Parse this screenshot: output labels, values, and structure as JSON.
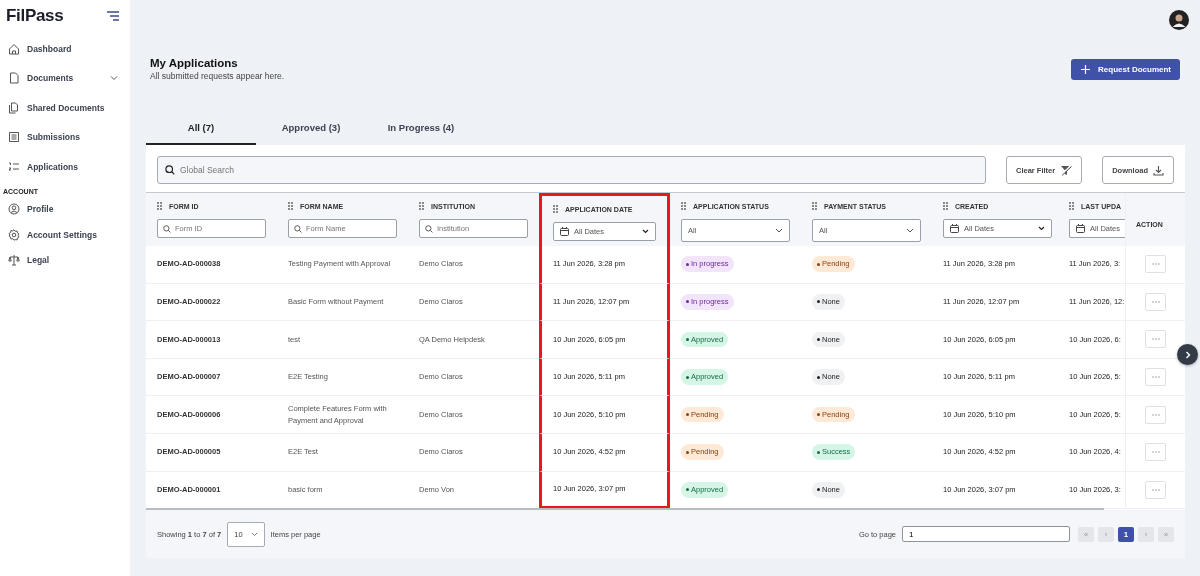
{
  "brand": {
    "logo": "FilPass"
  },
  "sidebar": {
    "items": [
      {
        "label": "Dashboard",
        "selected": false
      },
      {
        "label": "Documents",
        "selected": false,
        "expanded": false
      },
      {
        "label": "Shared Documents",
        "selected": false
      },
      {
        "label": "Submissions",
        "selected": false
      },
      {
        "label": "Applications",
        "selected": false
      }
    ],
    "section": "ACCOUNT",
    "account_items": [
      {
        "label": "Profile",
        "selected": false
      },
      {
        "label": "Account Settings",
        "selected": false
      },
      {
        "label": "Legal",
        "selected": false
      }
    ]
  },
  "header": {
    "title": "My Applications",
    "subtitle": "All submitted requests appear here.",
    "button": "Request Document"
  },
  "tabs": [
    {
      "label": "All (7)",
      "selected": true
    },
    {
      "label": "Approved (3)",
      "selected": false
    },
    {
      "label": "In Progress (4)",
      "selected": false
    }
  ],
  "search": {
    "placeholder": "Global Search"
  },
  "toolbar": {
    "clear_filter": "Clear Filter",
    "download": "Download"
  },
  "table": {
    "columns": [
      {
        "label": "FORM ID",
        "highlighted": false,
        "filter": {
          "kind": "text",
          "placeholder": "Form ID"
        }
      },
      {
        "label": "FORM NAME",
        "highlighted": false,
        "filter": {
          "kind": "text",
          "placeholder": "Form Name"
        }
      },
      {
        "label": "INSTITUTION",
        "highlighted": false,
        "filter": {
          "kind": "text",
          "placeholder": "Institution"
        }
      },
      {
        "label": "APPLICATION DATE",
        "highlighted": true,
        "filter": {
          "kind": "date",
          "value": "All Dates"
        }
      },
      {
        "label": "APPLICATION STATUS",
        "highlighted": false,
        "filter": {
          "kind": "select",
          "value": "All"
        }
      },
      {
        "label": "PAYMENT STATUS",
        "highlighted": false,
        "filter": {
          "kind": "select",
          "value": "All"
        }
      },
      {
        "label": "CREATED",
        "highlighted": false,
        "filter": {
          "kind": "date",
          "value": "All Dates"
        }
      },
      {
        "label": "LAST UPDA",
        "highlighted": false,
        "filter": {
          "kind": "date",
          "value": "All Dates"
        }
      },
      {
        "label": "ACTION",
        "highlighted": false
      }
    ],
    "rows": [
      {
        "form_id": "DEMO-AD-000038",
        "form_name": "Testing Payment with Approval",
        "institution": "Demo Claros",
        "application_date": "11 Jun 2026, 3:28 pm",
        "application_status": {
          "text": "In progress",
          "kind": "progress"
        },
        "payment_status": {
          "text": "Pending",
          "kind": "pending"
        },
        "created": "11 Jun 2026, 3:28 pm",
        "last_updated": "11 Jun 2026, 3:"
      },
      {
        "form_id": "DEMO-AD-000022",
        "form_name": "Basic Form without Payment",
        "institution": "Demo Claros",
        "application_date": "11 Jun 2026, 12:07 pm",
        "application_status": {
          "text": "In progress",
          "kind": "progress"
        },
        "payment_status": {
          "text": "None",
          "kind": "none"
        },
        "created": "11 Jun 2026, 12:07 pm",
        "last_updated": "11 Jun 2026, 12:"
      },
      {
        "form_id": "DEMO-AD-000013",
        "form_name": "test",
        "institution": "QA Demo Helpdesk",
        "application_date": "10 Jun 2026, 6:05 pm",
        "application_status": {
          "text": "Approved",
          "kind": "approved"
        },
        "payment_status": {
          "text": "None",
          "kind": "none"
        },
        "created": "10 Jun 2026, 6:05 pm",
        "last_updated": "10 Jun 2026, 6:"
      },
      {
        "form_id": "DEMO-AD-000007",
        "form_name": "E2E Testing",
        "institution": "Demo Claros",
        "application_date": "10 Jun 2026, 5:11 pm",
        "application_status": {
          "text": "Approved",
          "kind": "approved"
        },
        "payment_status": {
          "text": "None",
          "kind": "none"
        },
        "created": "10 Jun 2026, 5:11 pm",
        "last_updated": "10 Jun 2026, 5:"
      },
      {
        "form_id": "DEMO-AD-000006",
        "form_name": "Complete Features Form with Payment and Approval",
        "institution": "Demo Claros",
        "application_date": "10 Jun 2026, 5:10 pm",
        "application_status": {
          "text": "Pending",
          "kind": "pending"
        },
        "payment_status": {
          "text": "Pending",
          "kind": "pending"
        },
        "created": "10 Jun 2026, 5:10 pm",
        "last_updated": "10 Jun 2026, 5:"
      },
      {
        "form_id": "DEMO-AD-000005",
        "form_name": "E2E Test",
        "institution": "Demo Claros",
        "application_date": "10 Jun 2026, 4:52 pm",
        "application_status": {
          "text": "Pending",
          "kind": "pending"
        },
        "payment_status": {
          "text": "Success",
          "kind": "success"
        },
        "created": "10 Jun 2026, 4:52 pm",
        "last_updated": "10 Jun 2026, 4:"
      },
      {
        "form_id": "DEMO-AD-000001",
        "form_name": "basic form",
        "institution": "Demo Von",
        "application_date": "10 Jun 2026, 3:07 pm",
        "application_status": {
          "text": "Approved",
          "kind": "approved"
        },
        "payment_status": {
          "text": "None",
          "kind": "none"
        },
        "created": "10 Jun 2026, 3:07 pm",
        "last_updated": "10 Jun 2026, 3:"
      }
    ]
  },
  "footer": {
    "showing": "Showing **1** to **7** of **7**",
    "page_size": "10",
    "page_size_label": "Items per page",
    "go_to_label": "Go to page",
    "go_to_value": "1",
    "pager": [
      {
        "label": "«",
        "selected": false
      },
      {
        "label": "‹",
        "selected": false
      },
      {
        "label": "1",
        "selected": true
      },
      {
        "label": "›",
        "selected": false
      },
      {
        "label": "»",
        "selected": false
      }
    ]
  }
}
